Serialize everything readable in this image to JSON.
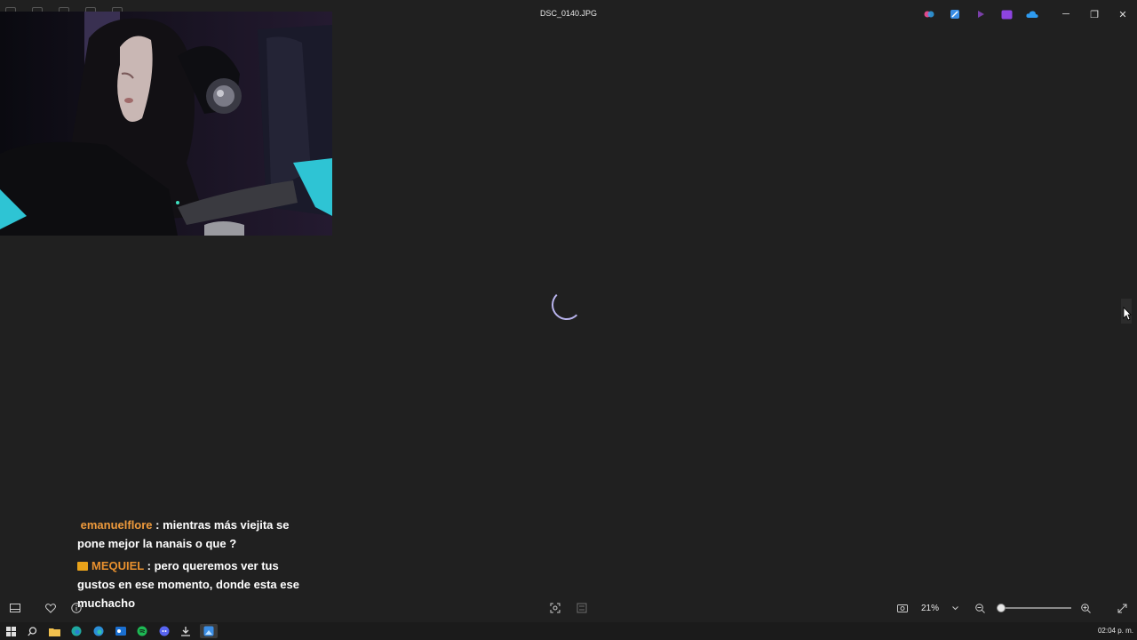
{
  "window": {
    "title": "DSC_0140.JPG",
    "controls": {
      "minimize": "─",
      "maximize": "❐",
      "close": "✕"
    },
    "toolbar_icons": [
      "edit-icon",
      "crop-icon",
      "rotate-icon",
      "delete-icon",
      "more-icon"
    ],
    "app_icons": [
      "copilot-icon",
      "photo-editor-icon",
      "clipchamp-icon",
      "purple-app-icon",
      "onedrive-icon"
    ]
  },
  "viewer": {
    "loading": true
  },
  "chat": {
    "messages": [
      {
        "user": "emanuelflore",
        "separator": " : ",
        "text": "mientras más viejita se pone mejor la nanais o que ?"
      },
      {
        "user": "MEQUIEL",
        "separator": " : ",
        "text": "pero queremos ver tus gustos en ese momento, donde esta ese muchacho"
      }
    ]
  },
  "bottom_bar": {
    "zoom_label": "21%",
    "zoom_level": 0.05,
    "icons": {
      "filmstrip": "filmstrip-icon",
      "favorite": "heart-icon",
      "info": "info-icon",
      "fit": "fit-icon",
      "compare": "compare-icon",
      "snapshot": "screenshot-icon",
      "zoom_out": "zoom-out-icon",
      "zoom_in": "zoom-in-icon",
      "fullscreen": "fullscreen-icon"
    }
  },
  "taskbar": {
    "clock": "02:04 p. m.",
    "apps": [
      "start",
      "search",
      "file-explorer",
      "edge",
      "edge-dev",
      "outlook",
      "spotify",
      "discord",
      "downloads",
      "photos"
    ]
  },
  "colors": {
    "background": "#202020",
    "username_color": "#ee9a3c",
    "spinner": "#b9b4ee"
  }
}
